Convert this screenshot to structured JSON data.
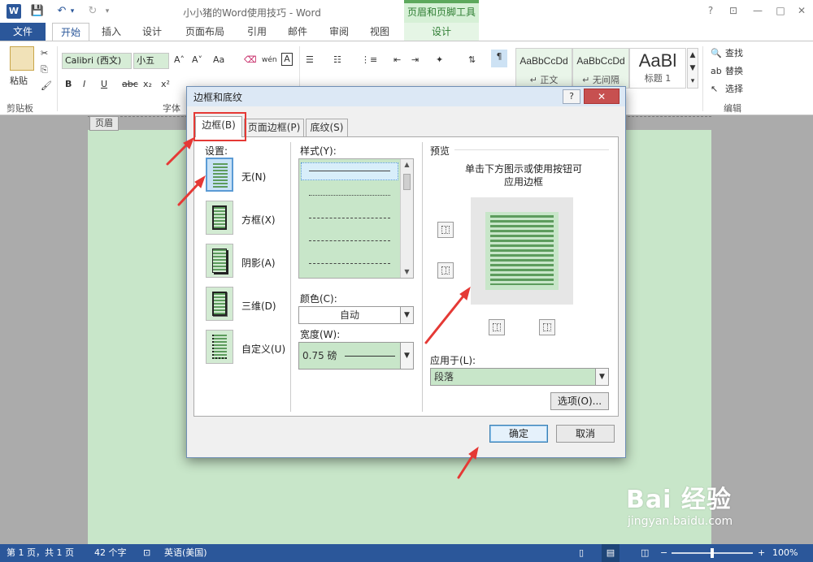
{
  "window": {
    "title": "小小猪的Word使用技巧 - Word",
    "app_icon": "W",
    "context_tab_header": "页眉和页脚工具",
    "help_btn": "?",
    "min_btn": "—",
    "max_btn": "□",
    "close_btn": "✕"
  },
  "ribbon_tabs": [
    {
      "label": "文件"
    },
    {
      "label": "开始"
    },
    {
      "label": "插入"
    },
    {
      "label": "设计"
    },
    {
      "label": "页面布局"
    },
    {
      "label": "引用"
    },
    {
      "label": "邮件"
    },
    {
      "label": "审阅"
    },
    {
      "label": "视图"
    },
    {
      "label": "设计"
    }
  ],
  "ribbon": {
    "paste": "粘贴",
    "clipboard_group": "剪贴板",
    "font_name": "Calibri (西文)",
    "font_size": "小五",
    "font_group": "字体",
    "format_btns": [
      "B",
      "I",
      "U",
      "abc",
      "x₂",
      "x²"
    ],
    "grow_font": "A˄",
    "shrink_font": "A˅",
    "change_case": "Aa",
    "wen": "wén",
    "char_border": "A",
    "styles": [
      {
        "sample": "AaBbCcDd",
        "name": "↵ 正文"
      },
      {
        "sample": "AaBbCcDd",
        "name": "↵ 无间隔"
      },
      {
        "sample": "AaBl",
        "name": "标题 1"
      }
    ],
    "find": "查找",
    "replace": "替换",
    "select": "选择",
    "edit_group": "编辑"
  },
  "document": {
    "header_label": "页眉"
  },
  "dialog": {
    "title": "边框和底纹",
    "help": "?",
    "close": "✕",
    "tabs": [
      {
        "label": "边框(B)"
      },
      {
        "label": "页面边框(P)"
      },
      {
        "label": "底纹(S)"
      }
    ],
    "settings_label": "设置:",
    "settings": [
      {
        "label": "无(N)"
      },
      {
        "label": "方框(X)"
      },
      {
        "label": "阴影(A)"
      },
      {
        "label": "三维(D)"
      },
      {
        "label": "自定义(U)"
      }
    ],
    "style_label": "样式(Y):",
    "color_label": "颜色(C):",
    "color_value": "自动",
    "width_label": "宽度(W):",
    "width_value": "0.75 磅",
    "preview_label": "预览",
    "preview_hint_line1": "单击下方图示或使用按钮可",
    "preview_hint_line2": "应用边框",
    "apply_label": "应用于(L):",
    "apply_value": "段落",
    "options_btn": "选项(O)...",
    "ok_btn": "确定",
    "cancel_btn": "取消"
  },
  "statusbar": {
    "page": "第 1 页，共 1 页",
    "words": "42 个字",
    "language": "英语(美国)",
    "zoom": "100%"
  },
  "watermark": {
    "brand": "Bai 经验",
    "url": "jingyan.baidu.com"
  },
  "colors": {
    "word_blue": "#2b579a",
    "page_green": "#c8e6c9",
    "annotation_red": "#e53935",
    "close_red": "#c75050"
  }
}
